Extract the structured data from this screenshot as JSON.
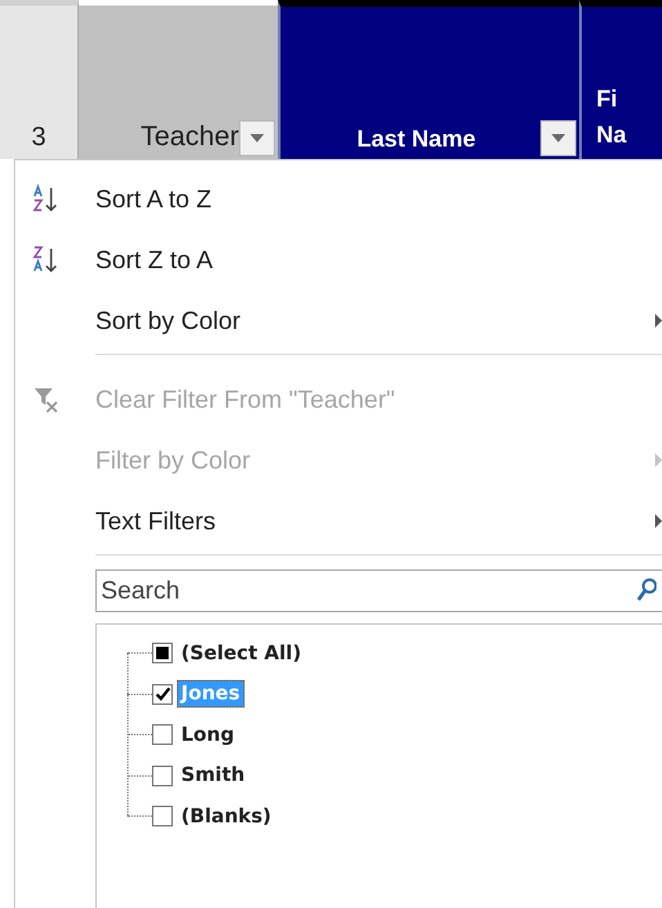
{
  "sheet_header": {
    "row_number": "3",
    "columns": [
      {
        "label": "Teacher",
        "kind": "active",
        "filter_button": true
      },
      {
        "label": "Last Name",
        "kind": "navy",
        "filter_button": true
      },
      {
        "label_lines": [
          "Fi",
          "Na"
        ],
        "kind": "navy",
        "filter_button": false
      }
    ]
  },
  "menu": {
    "items": [
      {
        "kind": "item",
        "label": "Sort A to Z",
        "disabled": false,
        "submenu": false
      },
      {
        "kind": "item",
        "label": "Sort Z to A",
        "disabled": false,
        "submenu": false
      },
      {
        "kind": "item",
        "label": "Sort by Color",
        "disabled": false,
        "submenu": true
      },
      {
        "kind": "separator"
      },
      {
        "kind": "item",
        "label": "Clear Filter From \"Teacher\"",
        "disabled": true,
        "submenu": false
      },
      {
        "kind": "item",
        "label": "Filter by Color",
        "disabled": true,
        "submenu": true
      },
      {
        "kind": "item",
        "label": "Text Filters",
        "disabled": false,
        "submenu": true
      },
      {
        "kind": "separator"
      }
    ],
    "search": {
      "placeholder": "Search"
    },
    "values": [
      {
        "label": "(Select All)",
        "checked": false,
        "partial": true,
        "selected": false
      },
      {
        "label": "Jones",
        "checked": true,
        "partial": false,
        "selected": true
      },
      {
        "label": "Long",
        "checked": false,
        "partial": false,
        "selected": false
      },
      {
        "label": "Smith",
        "checked": false,
        "partial": false,
        "selected": false
      },
      {
        "label": "(Blanks)",
        "checked": false,
        "partial": false,
        "selected": false
      }
    ]
  }
}
